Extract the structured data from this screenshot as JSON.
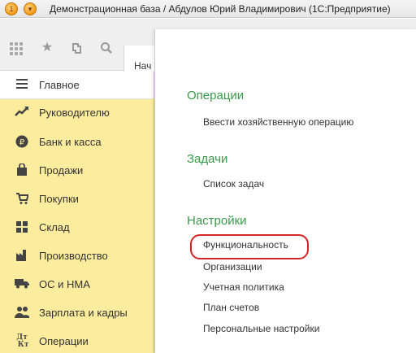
{
  "window": {
    "title": "Демонстрационная база / Абдулов Юрий Владимирович  (1С:Предприятие)"
  },
  "toolbar": {
    "icons": [
      "grid-icon",
      "star-icon",
      "history-icon",
      "search-icon"
    ],
    "open_tab_label": "Нач"
  },
  "sidebar": {
    "items": [
      {
        "label": "Главное",
        "icon": "menu-lines-icon",
        "active": true
      },
      {
        "label": "Руководителю",
        "icon": "trend-icon"
      },
      {
        "label": "Банк и касса",
        "icon": "ruble-coin-icon"
      },
      {
        "label": "Продажи",
        "icon": "shopping-bag-icon"
      },
      {
        "label": "Покупки",
        "icon": "cart-icon"
      },
      {
        "label": "Склад",
        "icon": "warehouse-icon"
      },
      {
        "label": "Производство",
        "icon": "factory-icon"
      },
      {
        "label": "ОС и НМА",
        "icon": "truck-icon"
      },
      {
        "label": "Зарплата и кадры",
        "icon": "people-icon"
      },
      {
        "label": "Операции",
        "icon": "dt-kt-icon"
      }
    ]
  },
  "panel": {
    "sections": [
      {
        "title": "Операции",
        "links": [
          "Ввести хозяйственную операцию"
        ]
      },
      {
        "title": "Задачи",
        "links": [
          "Список задач"
        ]
      },
      {
        "title": "Настройки",
        "links": [
          "Функциональность",
          "Организации",
          "Учетная политика",
          "План счетов",
          "Персональные настройки"
        ]
      }
    ],
    "highlighted_link": "Функциональность"
  },
  "colors": {
    "sidebar_bg": "#fbec9e",
    "section_title": "#3a9a4c",
    "highlight_ring": "#d42424"
  }
}
